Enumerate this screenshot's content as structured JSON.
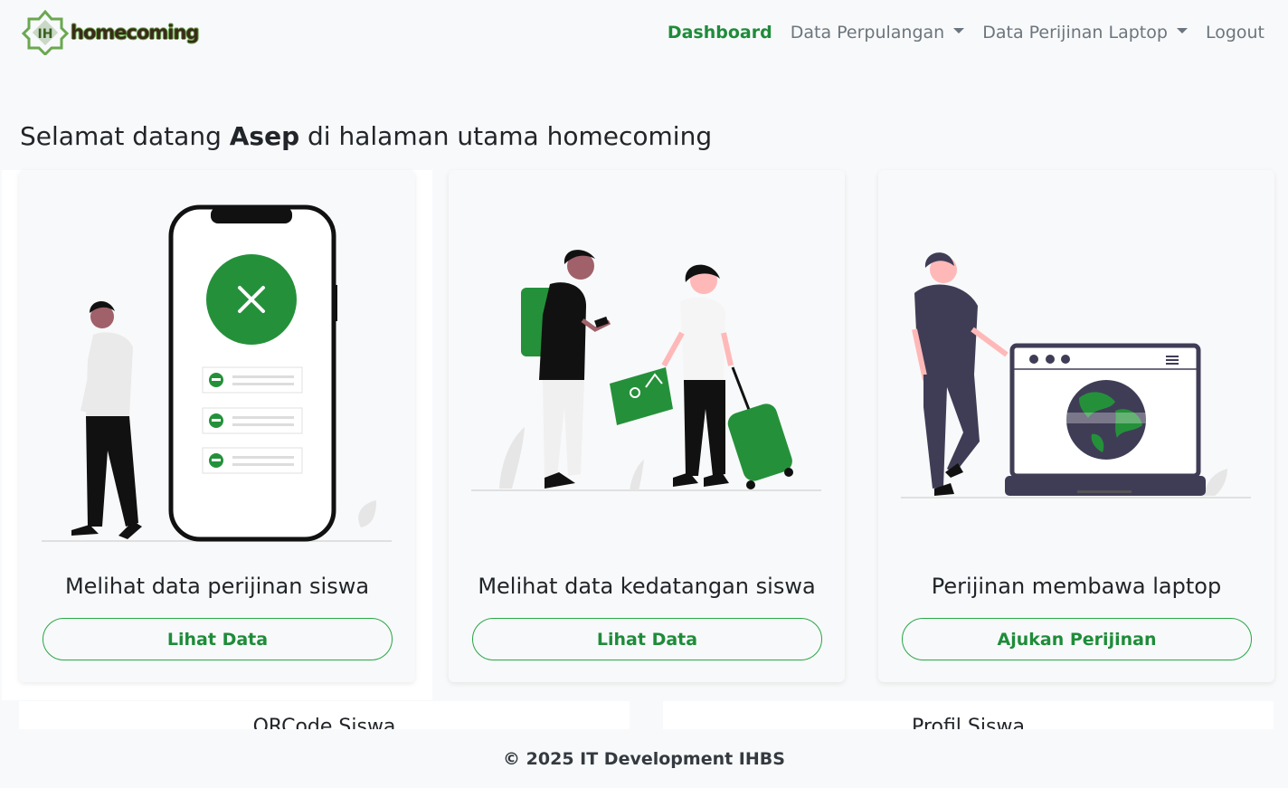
{
  "brand": {
    "name": "homecoming",
    "logo_glyph": "IH"
  },
  "nav": {
    "dashboard": "Dashboard",
    "data_perpulangan": "Data Perpulangan",
    "data_perijinan_laptop": "Data Perijinan Laptop",
    "logout": "Logout"
  },
  "welcome": {
    "prefix": "Selamat datang ",
    "user": "Asep",
    "suffix": " di halaman utama homecoming"
  },
  "cards": [
    {
      "title": "Melihat data perijinan siswa",
      "button": "Lihat Data"
    },
    {
      "title": "Melihat data kedatangan siswa",
      "button": "Lihat Data"
    },
    {
      "title": "Perijinan membawa laptop",
      "button": "Ajukan Perijinan"
    }
  ],
  "lower_cards": [
    {
      "title": "QRCode Siswa"
    },
    {
      "title": "Profil Siswa"
    }
  ],
  "footer": {
    "text": "© 2025 IT Development IHBS"
  },
  "colors": {
    "accent": "#28a745",
    "accent_dark": "#1e8c3a",
    "muted": "#6c757d"
  }
}
